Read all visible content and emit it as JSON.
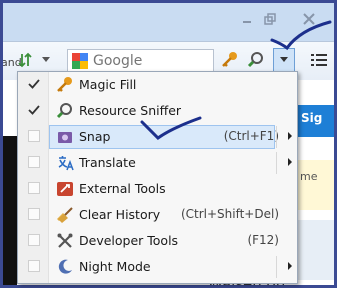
{
  "toolbar": {
    "search_placeholder": "Google",
    "left_fragment": "and"
  },
  "page": {
    "sign_fragment": "Sig",
    "me_fragment": "me",
    "bottom_text": "Walsen on"
  },
  "menu": {
    "items": [
      {
        "label": "Magic Fill",
        "checked": true,
        "icon": "key-icon",
        "shortcut": "",
        "submenu": false
      },
      {
        "label": "Resource Sniffer",
        "checked": true,
        "icon": "magnifier-icon",
        "shortcut": "",
        "submenu": false
      },
      {
        "label": "Snap",
        "checked": false,
        "icon": "camera-icon",
        "shortcut": "(Ctrl+F1)",
        "submenu": true,
        "highlighted": true
      },
      {
        "label": "Translate",
        "checked": false,
        "icon": "translate-icon",
        "shortcut": "",
        "submenu": true
      },
      {
        "label": "External Tools",
        "checked": false,
        "icon": "toolbox-icon",
        "shortcut": "",
        "submenu": false
      },
      {
        "label": "Clear History",
        "checked": false,
        "icon": "broom-icon",
        "shortcut": "(Ctrl+Shift+Del)",
        "submenu": false
      },
      {
        "label": "Developer Tools",
        "checked": false,
        "icon": "wrench-icon",
        "shortcut": "(F12)",
        "submenu": false
      },
      {
        "label": "Night Mode",
        "checked": false,
        "icon": "moon-icon",
        "shortcut": "",
        "submenu": true
      }
    ]
  },
  "colors": {
    "annotation": "#1c2f8c",
    "frame": "#3b4a93"
  }
}
